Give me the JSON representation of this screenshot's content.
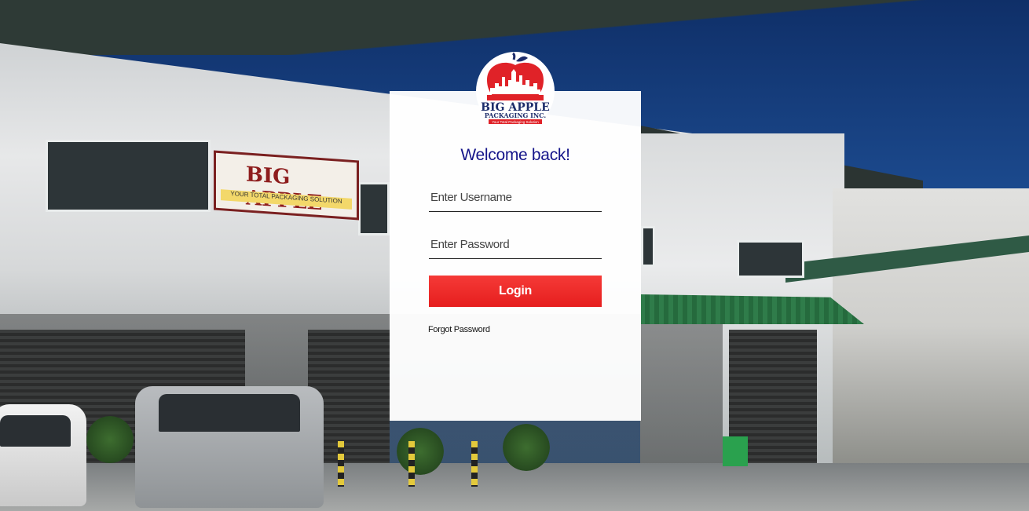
{
  "background": {
    "sign_text": "BIG APPLE",
    "sign_subtext": "YOUR TOTAL PACKAGING SOLUTION"
  },
  "logo": {
    "line1": "BIG APPLE",
    "line2": "PACKAGING INC.",
    "tagline": "Your Total Packaging Solution",
    "brand_red": "#e02228",
    "brand_navy": "#1d2d6b"
  },
  "login": {
    "welcome": "Welcome back!",
    "username_placeholder": "Enter Username",
    "password_placeholder": "Enter Password",
    "login_label": "Login",
    "forgot_label": "Forgot Password",
    "accent_color": "#ee2a29"
  }
}
